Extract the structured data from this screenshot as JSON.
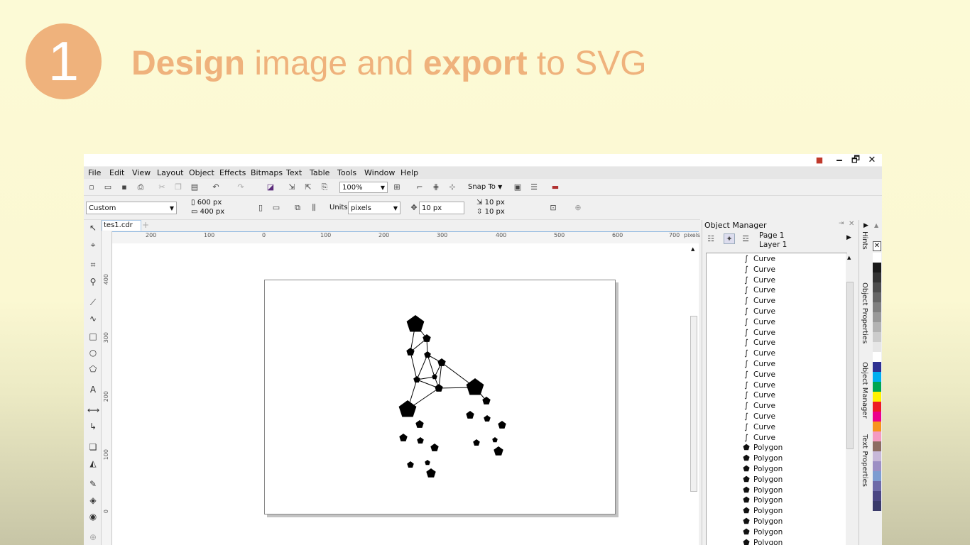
{
  "slide": {
    "step_number": "1",
    "headline_parts": [
      {
        "text": "Design",
        "bold": true
      },
      {
        "text": " image and ",
        "bold": false
      },
      {
        "text": "export",
        "bold": true
      },
      {
        "text": " to SVG",
        "bold": false
      }
    ]
  },
  "window": {
    "minimize": "🗕",
    "restore": "🗗",
    "close": "✕"
  },
  "menu": [
    "File",
    "Edit",
    "View",
    "Layout",
    "Object",
    "Effects",
    "Bitmaps",
    "Text",
    "Table",
    "Tools",
    "Window",
    "Help"
  ],
  "toolbar": {
    "zoom": "100%",
    "snap_to": "Snap To"
  },
  "propbar": {
    "page_preset": "Custom",
    "width": "600 px",
    "height": "400 px",
    "units_label": "Units:",
    "units": "pixels",
    "nudge": "10 px",
    "dup_x": "10 px",
    "dup_y": "10 px"
  },
  "document": {
    "tab": "tes1.cdr"
  },
  "ruler": {
    "h_labels": [
      "200",
      "100",
      "0",
      "100",
      "200",
      "300",
      "400",
      "500",
      "600",
      "700",
      "pixels"
    ],
    "v_labels": [
      "400",
      "300",
      "200",
      "100",
      "0"
    ]
  },
  "object_manager": {
    "title": "Object Manager",
    "page": "Page 1",
    "layer": "Layer 1",
    "items": [
      {
        "type": "curve",
        "label": "Curve"
      },
      {
        "type": "curve",
        "label": "Curve"
      },
      {
        "type": "curve",
        "label": "Curve"
      },
      {
        "type": "curve",
        "label": "Curve"
      },
      {
        "type": "curve",
        "label": "Curve"
      },
      {
        "type": "curve",
        "label": "Curve"
      },
      {
        "type": "curve",
        "label": "Curve"
      },
      {
        "type": "curve",
        "label": "Curve"
      },
      {
        "type": "curve",
        "label": "Curve"
      },
      {
        "type": "curve",
        "label": "Curve"
      },
      {
        "type": "curve",
        "label": "Curve"
      },
      {
        "type": "curve",
        "label": "Curve"
      },
      {
        "type": "curve",
        "label": "Curve"
      },
      {
        "type": "curve",
        "label": "Curve"
      },
      {
        "type": "curve",
        "label": "Curve"
      },
      {
        "type": "curve",
        "label": "Curve"
      },
      {
        "type": "curve",
        "label": "Curve"
      },
      {
        "type": "curve",
        "label": "Curve"
      },
      {
        "type": "polygon",
        "label": "Polygon"
      },
      {
        "type": "polygon",
        "label": "Polygon"
      },
      {
        "type": "polygon",
        "label": "Polygon"
      },
      {
        "type": "polygon",
        "label": "Polygon"
      },
      {
        "type": "polygon",
        "label": "Polygon"
      },
      {
        "type": "polygon",
        "label": "Polygon"
      },
      {
        "type": "polygon",
        "label": "Polygon"
      },
      {
        "type": "polygon",
        "label": "Polygon"
      },
      {
        "type": "polygon",
        "label": "Polygon"
      },
      {
        "type": "polygon",
        "label": "Polygon"
      }
    ]
  },
  "docker_tabs": [
    "Hints",
    "Object Properties",
    "Object Manager",
    "Text Properties"
  ],
  "palette": [
    "#ffffff",
    "#1a1a1a",
    "#333333",
    "#4d4d4d",
    "#666666",
    "#808080",
    "#999999",
    "#b3b3b3",
    "#cccccc",
    "#e6e6e6",
    "#ffffff",
    "#2e3192",
    "#00aeef",
    "#00a651",
    "#fff200",
    "#ed1c24",
    "#ec008c",
    "#f7941d",
    "#f49ac1",
    "#8c6d62",
    "#c7b8d9",
    "#9c8fc4",
    "#7d9cd1",
    "#6d6aa8",
    "#4b4683",
    "#3a3a6a"
  ]
}
